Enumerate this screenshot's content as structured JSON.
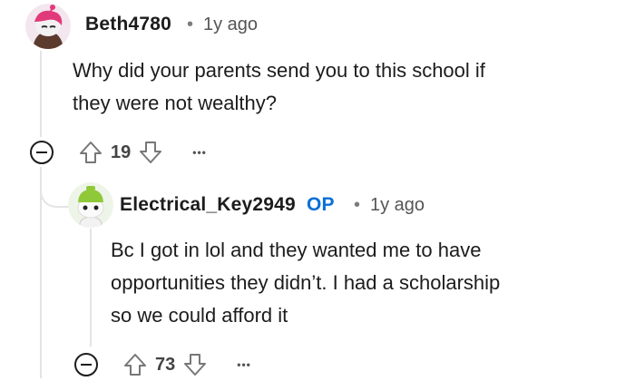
{
  "comments": [
    {
      "username": "Beth4780",
      "separator": "•",
      "timestamp": "1y ago",
      "body_lines": [
        "Why did your parents send you to this school if",
        "they were not wealthy?"
      ],
      "votes": "19",
      "more": "•••",
      "avatar_icon": "snoo-avatar-pink-icon"
    },
    {
      "username": "Electrical_Key2949",
      "op_badge": "OP",
      "separator": "•",
      "timestamp": "1y ago",
      "body_lines": [
        "Bc I got in lol and they wanted me to have",
        "opportunities they didn’t. I had a scholarship",
        "so we could afford it"
      ],
      "votes": "73",
      "more": "•••",
      "avatar_icon": "snoo-avatar-green-icon"
    }
  ],
  "colors": {
    "op_badge": "#0a6fd6",
    "thread_line": "#e2e4e6",
    "text": "#1c1c1c",
    "muted": "#555555"
  }
}
